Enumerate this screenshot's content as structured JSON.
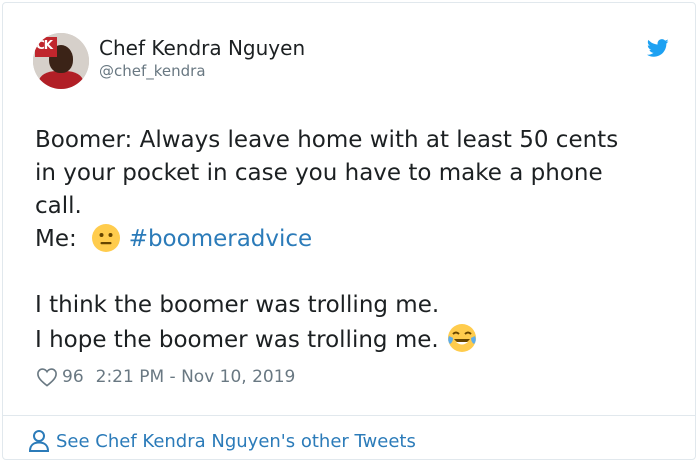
{
  "tweet": {
    "author_name": "Chef Kendra Nguyen",
    "author_handle": "@chef_kendra",
    "avatar_logo_text": "CK",
    "line1": "Boomer: Always leave home with at least 50 cents",
    "line2": "in your pocket in case you have to make a phone",
    "line3": "call.",
    "line4_prefix": "Me:  ",
    "emoji_neutral": "neutral-face-icon",
    "hashtag": "#boomeradvice",
    "line5": "I think the boomer was trolling me.",
    "line6": "I hope the boomer was trolling me.",
    "emoji_laugh": "tears-of-joy-icon",
    "likes": "96",
    "timestamp": "2:21 PM - Nov 10, 2019"
  },
  "footer": {
    "link_text": "See Chef Kendra Nguyen's other Tweets",
    "icon": "person-icon"
  },
  "colors": {
    "link": "#2b7bb9",
    "muted": "#697882",
    "text": "#1c2022",
    "twitter_blue": "#1da1f2",
    "border": "#e1e8ed"
  }
}
